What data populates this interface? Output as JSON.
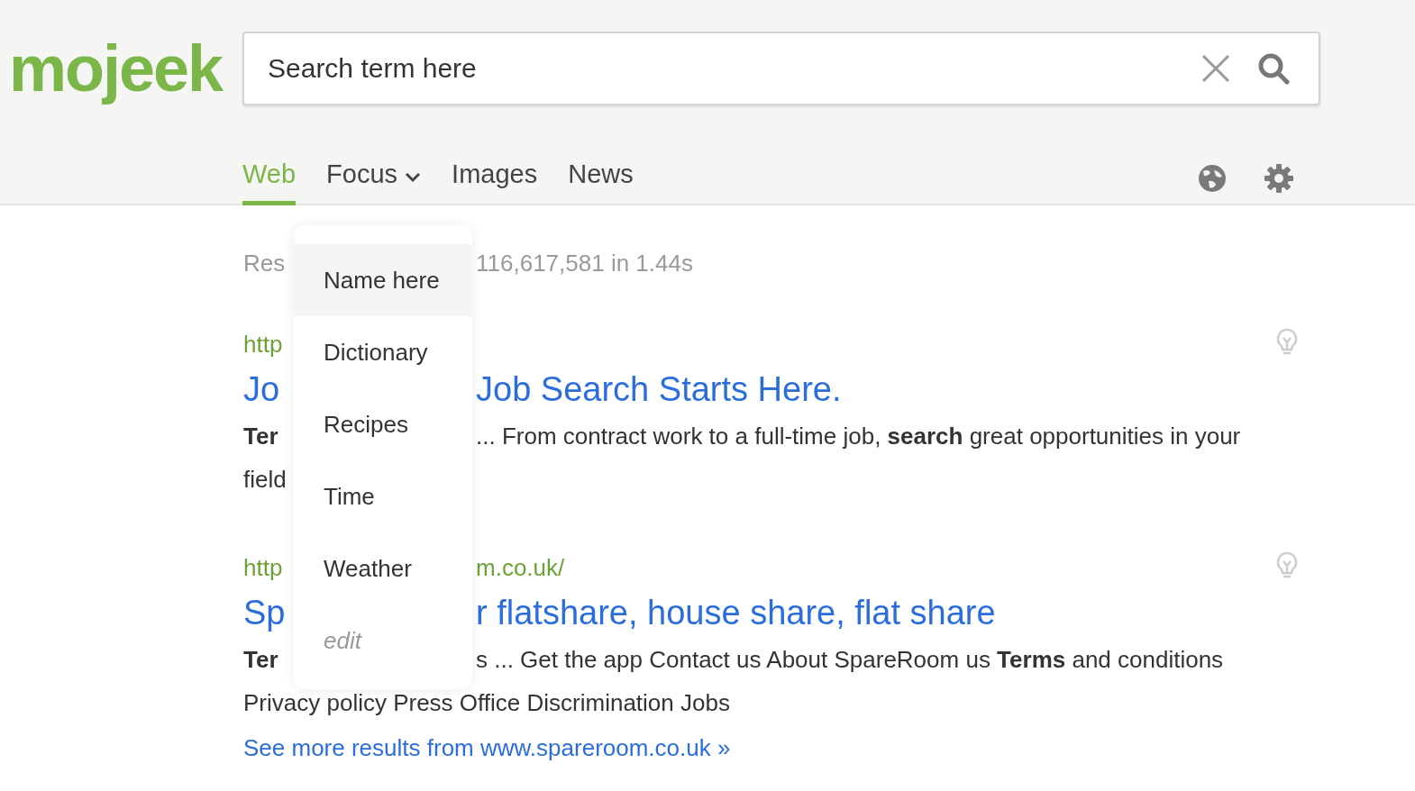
{
  "logo": "mojeek",
  "search": {
    "placeholder": "Search term here"
  },
  "tabs": [
    {
      "label": "Web",
      "selected": true,
      "kind": "plain"
    },
    {
      "label": "Focus",
      "selected": false,
      "kind": "dropdown",
      "expanded": true
    },
    {
      "label": "Images",
      "selected": false,
      "kind": "plain"
    },
    {
      "label": "News",
      "selected": false,
      "kind": "plain"
    }
  ],
  "focus_menu": [
    {
      "label": "Name here",
      "selected": true,
      "kind": "item"
    },
    {
      "label": "Dictionary",
      "selected": false,
      "kind": "item"
    },
    {
      "label": "Recipes",
      "selected": false,
      "kind": "item"
    },
    {
      "label": "Time",
      "selected": false,
      "kind": "item"
    },
    {
      "label": "Weather",
      "selected": false,
      "kind": "item"
    },
    {
      "label": "edit",
      "selected": false,
      "kind": "edit"
    }
  ],
  "results_count": {
    "left": "Res",
    "right": "116,617,581 in 1.44s"
  },
  "results": [
    {
      "url": {
        "left": "http"
      },
      "title": {
        "left": "Jo",
        "right": "Job Search Starts Here."
      },
      "snippet": {
        "left": "**Ter**",
        "right": "... From contract work to a full-time job, **search** great opportunities in your"
      },
      "snippet_more": "field"
    },
    {
      "url": {
        "left": "http",
        "right": "m.co.uk/"
      },
      "title": {
        "left": "Sp",
        "right": "r flatshare, house share, flat share"
      },
      "snippet": {
        "left": "**Ter**",
        "right": "s ... Get the app Contact us About SpareRoom us **Terms** and conditions"
      },
      "snippet_more": "Privacy policy Press Office Discrimination Jobs",
      "more_link": "See more results from www.spareroom.co.uk »"
    }
  ]
}
